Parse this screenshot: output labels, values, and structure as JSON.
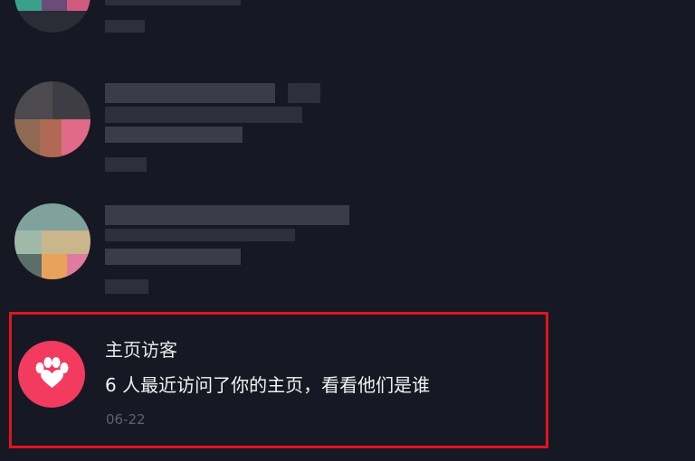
{
  "messages": [
    {
      "sender": "",
      "preview": "",
      "time": "",
      "redacted": true
    },
    {
      "sender": "",
      "preview": "",
      "time": "",
      "redacted": true
    },
    {
      "sender": "",
      "preview": "",
      "time": "",
      "redacted": true
    }
  ],
  "visitors": {
    "icon": "paw-heart-icon",
    "title": "主页访客",
    "description": "6 人最近访问了你的主页，看看他们是谁",
    "date": "06-22"
  },
  "colors": {
    "background": "#161823",
    "visitor_icon_bg": "#f33b5f",
    "highlight_border": "#e0141e"
  }
}
